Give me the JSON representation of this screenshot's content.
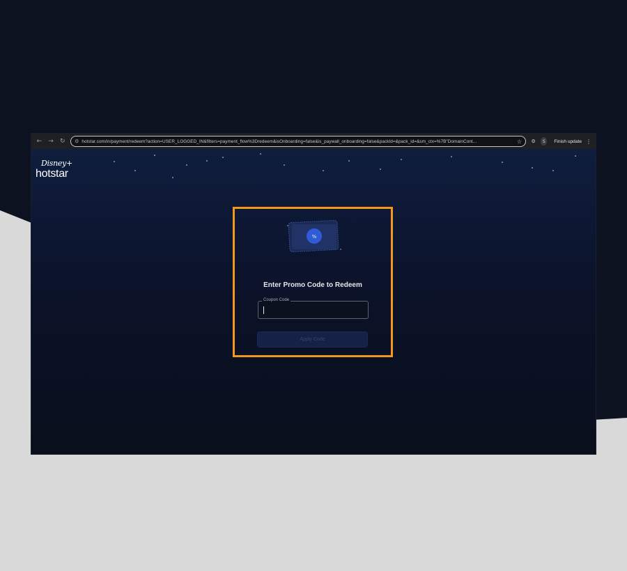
{
  "browser": {
    "url": "hotstar.com/in/payment/redeem?action=USER_LOGGED_IN&filters=payment_flow%3Dredeem&isOnboarding=false&is_paywall_onboarding=false&packId=&pack_id=&sm_ctx=%7B\"DomainCont...",
    "finish_update_label": "Finish update",
    "profile_initial": "S",
    "icons": {
      "back": "arrow-left-icon",
      "forward": "arrow-right-icon",
      "reload": "reload-icon",
      "site_info": "tune-icon",
      "bookmark": "star-icon",
      "extension": "extension-icon",
      "menu": "kebab-menu-icon"
    }
  },
  "logo": {
    "disney": "Disney+",
    "hotstar": "hotstar"
  },
  "promo": {
    "title": "Enter Promo Code to Redeem",
    "coupon_label": "Coupon Code",
    "coupon_value": "",
    "apply_label": "Apply Code"
  },
  "colors": {
    "highlight": "#f5961e",
    "page_bg_top": "#0f1e3e",
    "page_bg_bottom": "#0a0f1c",
    "accent_blue": "#2f5bd6"
  }
}
